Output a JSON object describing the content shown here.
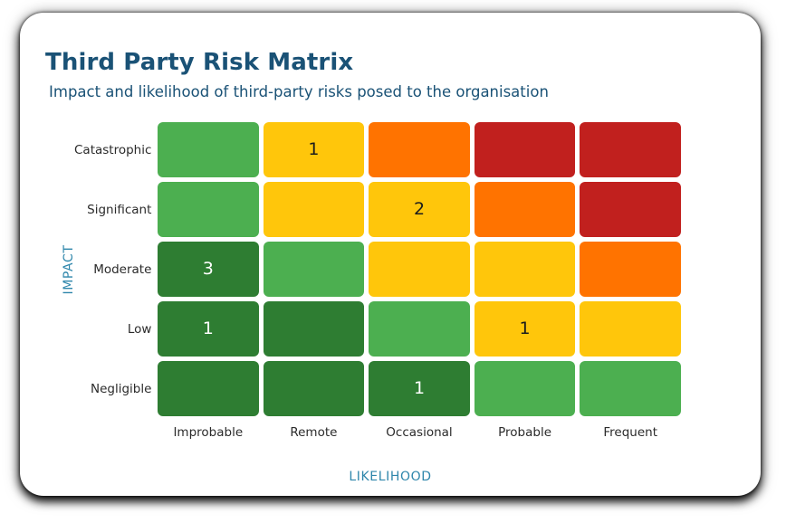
{
  "card": {
    "title": "Third Party Risk Matrix",
    "subtitle": "Impact and likelihood of third-party risks posed to the organisation",
    "title_color": "#1A5276",
    "subtitle_color": "#1A5276"
  },
  "axes": {
    "y_title": "IMPACT",
    "x_title": "LIKELIHOOD",
    "axis_title_color": "#2E86AB"
  },
  "legend_colors": {
    "very_low": "#2E7D32",
    "low": "#4CAF50",
    "medium": "#FFC60B",
    "high": "#FF7300",
    "very_high": "#C1201E"
  },
  "chart_data": {
    "type": "heatmap",
    "title": "Third Party Risk Matrix",
    "subtitle": "Impact and likelihood of third-party risks posed to the organisation",
    "xlabel": "LIKELIHOOD",
    "ylabel": "IMPACT",
    "x_categories": [
      "Improbable",
      "Remote",
      "Occasional",
      "Probable",
      "Frequent"
    ],
    "y_categories": [
      "Catastrophic",
      "Significant",
      "Moderate",
      "Low",
      "Negligible"
    ],
    "grid": false,
    "legend": "none",
    "cells": [
      [
        {
          "color": "#4CAF50",
          "count": "",
          "text_color": "#ffffff"
        },
        {
          "color": "#FFC60B",
          "count": "1",
          "text_color": "#1c1c1c"
        },
        {
          "color": "#FF7300",
          "count": "",
          "text_color": "#1c1c1c"
        },
        {
          "color": "#C1201E",
          "count": "",
          "text_color": "#ffffff"
        },
        {
          "color": "#C1201E",
          "count": "",
          "text_color": "#ffffff"
        }
      ],
      [
        {
          "color": "#4CAF50",
          "count": "",
          "text_color": "#ffffff"
        },
        {
          "color": "#FFC60B",
          "count": "",
          "text_color": "#1c1c1c"
        },
        {
          "color": "#FFC60B",
          "count": "2",
          "text_color": "#1c1c1c"
        },
        {
          "color": "#FF7300",
          "count": "",
          "text_color": "#1c1c1c"
        },
        {
          "color": "#C1201E",
          "count": "",
          "text_color": "#ffffff"
        }
      ],
      [
        {
          "color": "#2E7D32",
          "count": "3",
          "text_color": "#ffffff"
        },
        {
          "color": "#4CAF50",
          "count": "",
          "text_color": "#ffffff"
        },
        {
          "color": "#FFC60B",
          "count": "",
          "text_color": "#1c1c1c"
        },
        {
          "color": "#FFC60B",
          "count": "",
          "text_color": "#1c1c1c"
        },
        {
          "color": "#FF7300",
          "count": "",
          "text_color": "#1c1c1c"
        }
      ],
      [
        {
          "color": "#2E7D32",
          "count": "1",
          "text_color": "#ffffff"
        },
        {
          "color": "#2E7D32",
          "count": "",
          "text_color": "#ffffff"
        },
        {
          "color": "#4CAF50",
          "count": "",
          "text_color": "#ffffff"
        },
        {
          "color": "#FFC60B",
          "count": "1",
          "text_color": "#1c1c1c"
        },
        {
          "color": "#FFC60B",
          "count": "",
          "text_color": "#1c1c1c"
        }
      ],
      [
        {
          "color": "#2E7D32",
          "count": "",
          "text_color": "#ffffff"
        },
        {
          "color": "#2E7D32",
          "count": "",
          "text_color": "#ffffff"
        },
        {
          "color": "#2E7D32",
          "count": "1",
          "text_color": "#ffffff"
        },
        {
          "color": "#4CAF50",
          "count": "",
          "text_color": "#ffffff"
        },
        {
          "color": "#4CAF50",
          "count": "",
          "text_color": "#ffffff"
        }
      ]
    ],
    "risk_entries": [
      {
        "impact": "Catastrophic",
        "likelihood": "Remote",
        "count": 1
      },
      {
        "impact": "Significant",
        "likelihood": "Occasional",
        "count": 2
      },
      {
        "impact": "Moderate",
        "likelihood": "Improbable",
        "count": 3
      },
      {
        "impact": "Low",
        "likelihood": "Improbable",
        "count": 1
      },
      {
        "impact": "Low",
        "likelihood": "Probable",
        "count": 1
      },
      {
        "impact": "Negligible",
        "likelihood": "Occasional",
        "count": 1
      }
    ]
  }
}
